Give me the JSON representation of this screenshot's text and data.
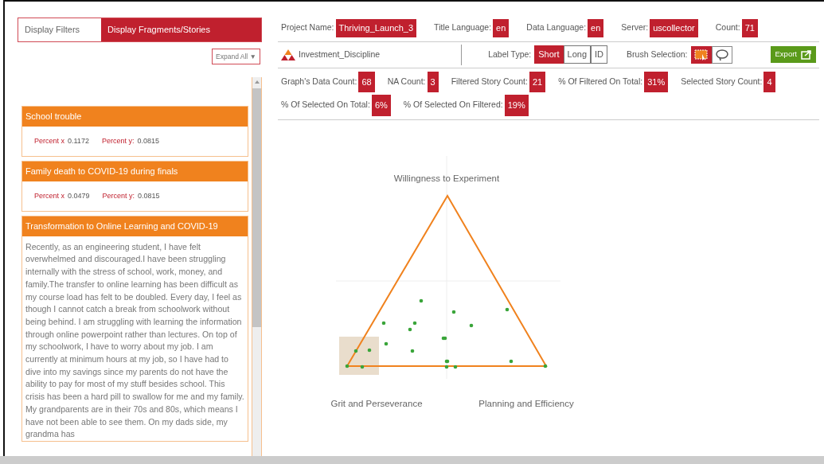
{
  "left_panel": {
    "tabs": [
      {
        "label": "Display Filters",
        "selected": false
      },
      {
        "label": "Display Fragments/Stories",
        "selected": true
      }
    ],
    "expand_button": {
      "label": "Expand All",
      "icon": "▼"
    },
    "stories": [
      {
        "kind": "coordinates",
        "title": "School trouble",
        "x_label": "Percent x",
        "x_value": "0.1172",
        "y_label": "Percent y:",
        "y_value": "0.0815"
      },
      {
        "kind": "coordinates",
        "title": "Family death to COVID-19 during finals",
        "x_label": "Percent x",
        "x_value": "0.0479",
        "y_label": "Percent y:",
        "y_value": "0.0815"
      },
      {
        "kind": "text",
        "title": "Transformation to Online Learning and COVID-19",
        "text": "Recently, as an engineering student, I have felt overwhelmed and discouraged.I have been struggling internally with the stress of school, work, money, and family.The transfer to online learning has been difficult as my course load has felt to be doubled. Every day, I feel as though I cannot catch a break from schoolwork without being behind. I am struggling with learning the information through online powerpoint rather than lectures. On top of my schoolwork, I have to worry about my job. I am currently at minimum hours at my job, so I have had to dive into my savings since my parents do not have the ability to pay for most of my stuff besides school. This crisis has been a hard pill to swallow for me and my family. My grandparents are in their 70s and 80s, which means I have not been able to see them. On my dads side, my grandma has"
      }
    ]
  },
  "project_info": [
    {
      "label": "Project Name:",
      "value": "Thriving_Launch_3"
    },
    {
      "label": "Title Language:",
      "value": "en"
    },
    {
      "label": "Data Language:",
      "value": "en"
    },
    {
      "label": "Server:",
      "value": "uscollector"
    },
    {
      "label": "Count:",
      "value": "71"
    }
  ],
  "toolbar": {
    "dataset": "Investment_Discipline",
    "label_type": "Label Type:",
    "label_options": [
      {
        "label": "Short",
        "selected": true
      },
      {
        "label": "Long",
        "selected": false
      },
      {
        "label": "ID",
        "selected": false
      }
    ],
    "brush_label": "Brush Selection:",
    "brush_tools": [
      {
        "kind": "rectangle",
        "selected": true
      },
      {
        "kind": "lasso",
        "selected": false
      }
    ],
    "export": "Export"
  },
  "stats": [
    {
      "label": "Graph's Data Count:",
      "value": "68"
    },
    {
      "label": "NA Count:",
      "value": "3"
    },
    {
      "label": "Filtered Story Count:",
      "value": "21"
    },
    {
      "label": "% Of Filtered On Total:",
      "value": "31%"
    },
    {
      "label": "Selected Story Count:",
      "value": "4"
    },
    {
      "label": "% Of Selected On Total:",
      "value": "6%"
    },
    {
      "label": "% Of Selected On Filtered:",
      "value": "19%"
    }
  ],
  "ternary_plot": {
    "top_label": "Willingness to Experiment",
    "left_label": "Grit and Perseverance",
    "right_label": "Planning and Efficiency"
  }
}
